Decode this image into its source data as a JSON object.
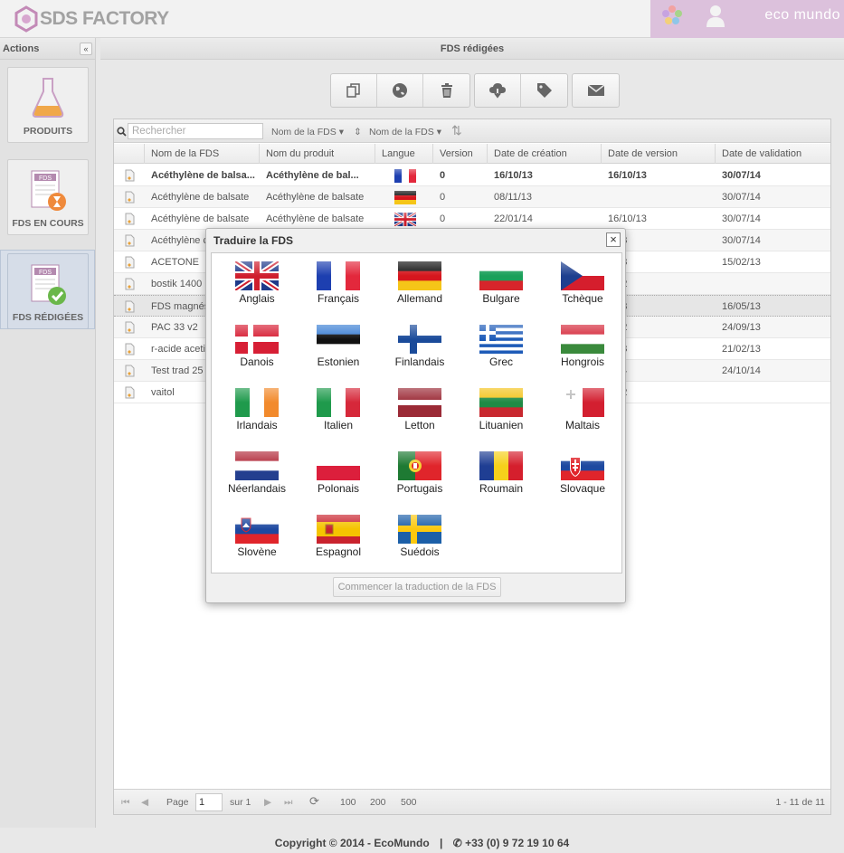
{
  "header": {
    "logo_text": "SDS FACTORY",
    "brand_right": "eco mundo"
  },
  "left_panel": {
    "title": "Actions",
    "collapse_label": "«",
    "items": [
      {
        "label": "PRODUITS",
        "icon": "flask-icon"
      },
      {
        "label": "FDS EN COURS",
        "icon": "fds-pending-icon"
      },
      {
        "label": "FDS RÉDIGÉES",
        "icon": "fds-done-icon",
        "active": true
      }
    ]
  },
  "main": {
    "title": "FDS rédigées",
    "toolbar": [
      "copy-icon",
      "globe-icon",
      "trash-icon",
      "cloud-download-icon",
      "tag-icon",
      "envelope-icon"
    ]
  },
  "grid": {
    "search_placeholder": "Rechercher",
    "sort1": "Nom de la FDS ▾",
    "sort2": "Nom de la FDS ▾",
    "columns": [
      "Nom de la FDS",
      "Nom du produit",
      "Langue",
      "Version",
      "Date de création",
      "Date de version",
      "Date de validation"
    ],
    "rows": [
      {
        "name": "Acéthylène de balsa...",
        "product": "Acéthylène de bal...",
        "flag": "fr",
        "version": "0",
        "created": "16/10/13",
        "versioned": "16/10/13",
        "validated": "30/07/14",
        "bold": true
      },
      {
        "name": "Acéthylène de balsate",
        "product": "Acéthylène de balsate",
        "flag": "de",
        "version": "0",
        "created": "08/11/13",
        "versioned": "",
        "validated": "30/07/14"
      },
      {
        "name": "Acéthylène de balsate",
        "product": "Acéthylène de balsate",
        "flag": "gb",
        "version": "0",
        "created": "22/01/14",
        "versioned": "16/10/13",
        "validated": "30/07/14"
      },
      {
        "name": "Acéthylène c",
        "product": "",
        "flag": "",
        "version": "",
        "created": "",
        "versioned": "0/13",
        "validated": "30/07/14"
      },
      {
        "name": "ACETONE",
        "product": "",
        "flag": "",
        "version": "",
        "created": "",
        "versioned": "2/13",
        "validated": "15/02/13"
      },
      {
        "name": "bostik 1400",
        "product": "",
        "flag": "",
        "version": "",
        "created": "",
        "versioned": "1/12",
        "validated": ""
      },
      {
        "name": "FDS magnés",
        "product": "",
        "flag": "",
        "version": "",
        "created": "",
        "versioned": "4/13",
        "validated": "16/05/13",
        "selected": true
      },
      {
        "name": "PAC 33 v2",
        "product": "",
        "flag": "",
        "version": "",
        "created": "",
        "versioned": "1/12",
        "validated": "24/09/13"
      },
      {
        "name": "r-acide aceti",
        "product": "",
        "flag": "",
        "version": "",
        "created": "",
        "versioned": "2/13",
        "validated": "21/02/13"
      },
      {
        "name": "Test trad 25",
        "product": "",
        "flag": "",
        "version": "",
        "created": "",
        "versioned": "0/14",
        "validated": "24/10/14"
      },
      {
        "name": "vaitol",
        "product": "",
        "flag": "",
        "version": "",
        "created": "",
        "versioned": "1/12",
        "validated": ""
      }
    ],
    "pager": {
      "page_label": "Page",
      "page_value": "1",
      "of_label": "sur 1",
      "sizes": [
        "100",
        "200",
        "500"
      ],
      "summary": "1 - 11 de 11"
    }
  },
  "dialog": {
    "title": "Traduire la FDS",
    "close_label": "×",
    "languages": [
      "Anglais",
      "Français",
      "Allemand",
      "Bulgare",
      "Tchèque",
      "Danois",
      "Estonien",
      "Finlandais",
      "Grec",
      "Hongrois",
      "Irlandais",
      "Italien",
      "Letton",
      "Lituanien",
      "Maltais",
      "Néerlandais",
      "Polonais",
      "Portugais",
      "Roumain",
      "Slovaque",
      "Slovène",
      "Espagnol",
      "Suédois"
    ],
    "start_button": "Commencer la traduction de la FDS"
  },
  "footer": {
    "copyright": "Copyright © 2014 - EcoMundo",
    "separator": "|",
    "phone": "+33 (0) 9 72 19 10 64"
  }
}
